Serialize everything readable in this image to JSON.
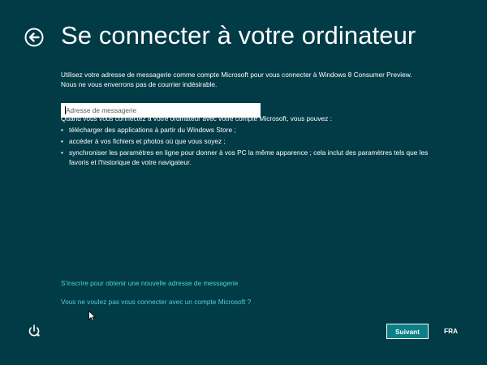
{
  "page": {
    "title": "Se connecter à votre ordinateur",
    "intro": "Utilisez votre adresse de messagerie comme compte Microsoft pour vous connecter à Windows 8 Consumer Preview. Nous ne vous enverrons pas de courrier indésirable."
  },
  "email": {
    "placeholder": "Adresse de messagerie",
    "value": ""
  },
  "benefits": {
    "heading": "Quand vous vous connectez à votre ordinateur avec votre compte Microsoft, vous pouvez :",
    "items": [
      {
        "bullet": "•",
        "text": "télécharger des applications à partir du Windows Store ;"
      },
      {
        "bullet": "•",
        "text": "accéder à vos fichiers et photos où que vous soyez ;"
      },
      {
        "bullet": "•",
        "text": "synchroniser les paramètres en ligne pour donner à vos PC la même apparence ; cela inclut des paramètres tels que les favoris et l'historique de votre navigateur."
      }
    ]
  },
  "links": {
    "signup": "S'inscrire pour obtenir une nouvelle adresse de messagerie",
    "no_account": "Vous ne voulez pas vous connecter avec un compte Microsoft ?"
  },
  "footer": {
    "next_label": "Suivant",
    "language": "FRA"
  },
  "icons": {
    "back": "back-arrow-circle-icon",
    "ease_of_access": "ease-of-access-icon",
    "cursor": "mouse-pointer-icon"
  },
  "colors": {
    "background": "#003b46",
    "link": "#4fd3d6",
    "button": "#0b7f86",
    "text": "#ffffff"
  }
}
